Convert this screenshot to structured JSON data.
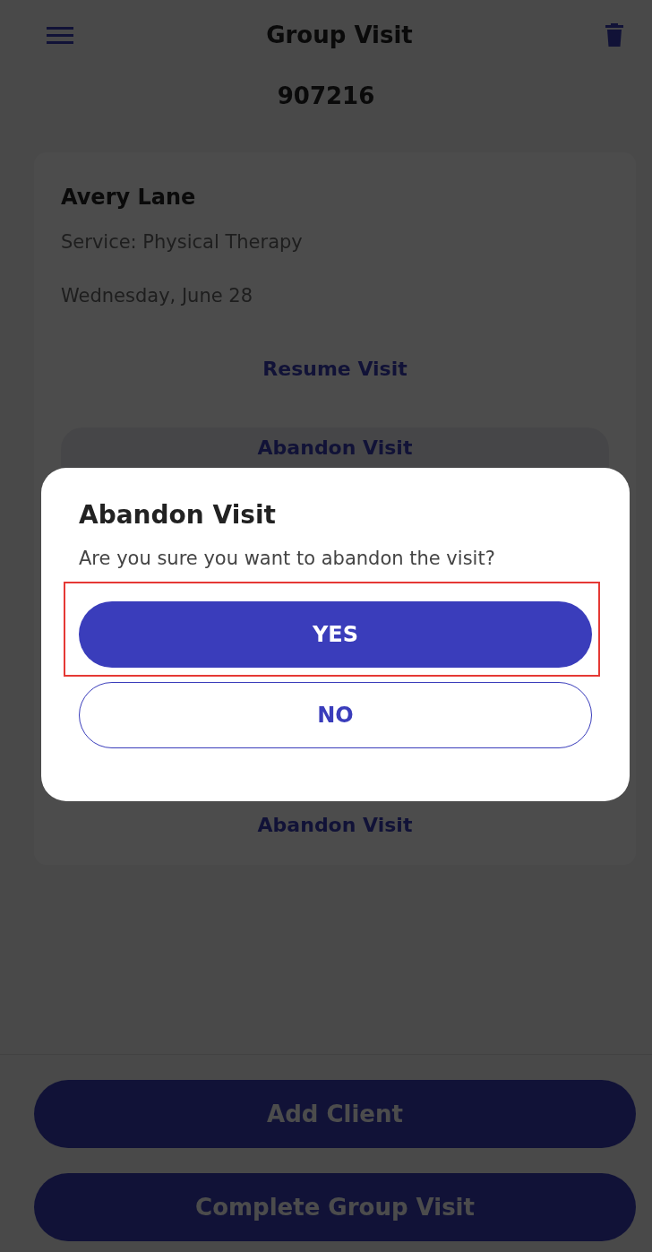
{
  "header": {
    "title": "Group Visit",
    "code": "907216"
  },
  "card": {
    "client_name": "Avery Lane",
    "service": "Service: Physical Therapy",
    "date": "Wednesday, June 28",
    "actions": [
      {
        "label": "Resume Visit",
        "kind": "link"
      },
      {
        "label": "Abandon Visit",
        "kind": "button"
      },
      {
        "label": "Abandon Visit",
        "kind": "link"
      }
    ]
  },
  "dialog": {
    "title": "Abandon Visit",
    "message": "Are you sure you want to abandon the visit?",
    "buttons": [
      {
        "label": "YES",
        "kind": "primary",
        "highlighted": true
      },
      {
        "label": "NO",
        "kind": "outline",
        "highlighted": false
      }
    ]
  },
  "footer": {
    "buttons": [
      {
        "label": "Add Client"
      },
      {
        "label": "Complete Group Visit"
      }
    ]
  }
}
